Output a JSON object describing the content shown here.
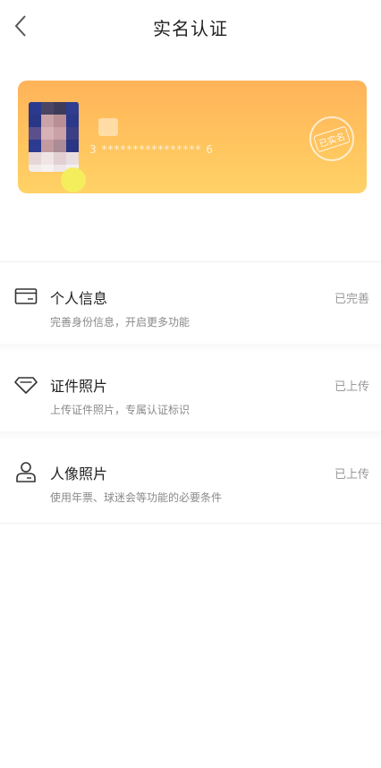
{
  "header": {
    "title": "实名认证"
  },
  "card": {
    "id_number": "3 **************** 6",
    "seal_text": "已实名",
    "gradient_colors": [
      "#ffb35a",
      "#ffd266"
    ]
  },
  "sections": [
    {
      "title": "个人信息",
      "subtitle": "完善身份信息，开启更多功能",
      "status": "已完善",
      "icon": "id-card-icon"
    },
    {
      "title": "证件照片",
      "subtitle": "上传证件照片，专属认证标识",
      "status": "已上传",
      "icon": "diamond-icon"
    },
    {
      "title": "人像照片",
      "subtitle": "使用年票、球迷会等功能的必要条件",
      "status": "已上传",
      "icon": "person-icon"
    }
  ]
}
